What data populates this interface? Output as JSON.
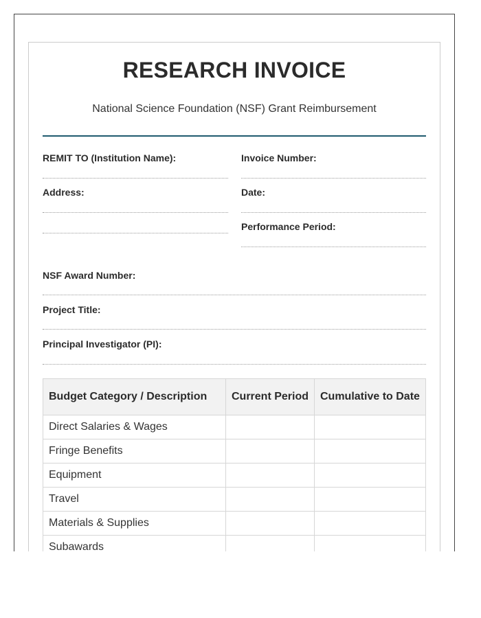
{
  "header": {
    "title": "RESEARCH INVOICE",
    "subtitle": "National Science Foundation (NSF) Grant Reimbursement"
  },
  "fields": {
    "remit_to": "REMIT TO (Institution Name):",
    "address": "Address:",
    "invoice_number": "Invoice Number:",
    "date": "Date:",
    "performance_period": "Performance Period:",
    "award_number": "NSF Award Number:",
    "project_title": "Project Title:",
    "principal_investigator": "Principal Investigator (PI):"
  },
  "table": {
    "headers": [
      "Budget Category / Description",
      "Current Period",
      "Cumulative to Date"
    ],
    "rows": [
      {
        "category": "Direct Salaries & Wages",
        "current": "",
        "cumulative": ""
      },
      {
        "category": "Fringe Benefits",
        "current": "",
        "cumulative": ""
      },
      {
        "category": "Equipment",
        "current": "",
        "cumulative": ""
      },
      {
        "category": "Travel",
        "current": "",
        "cumulative": ""
      },
      {
        "category": "Materials & Supplies",
        "current": "",
        "cumulative": ""
      },
      {
        "category": "Subawards",
        "current": "",
        "cumulative": ""
      }
    ]
  },
  "colors": {
    "accent_rule": "#1f5a6e",
    "header_fill": "#f2f2f2"
  }
}
